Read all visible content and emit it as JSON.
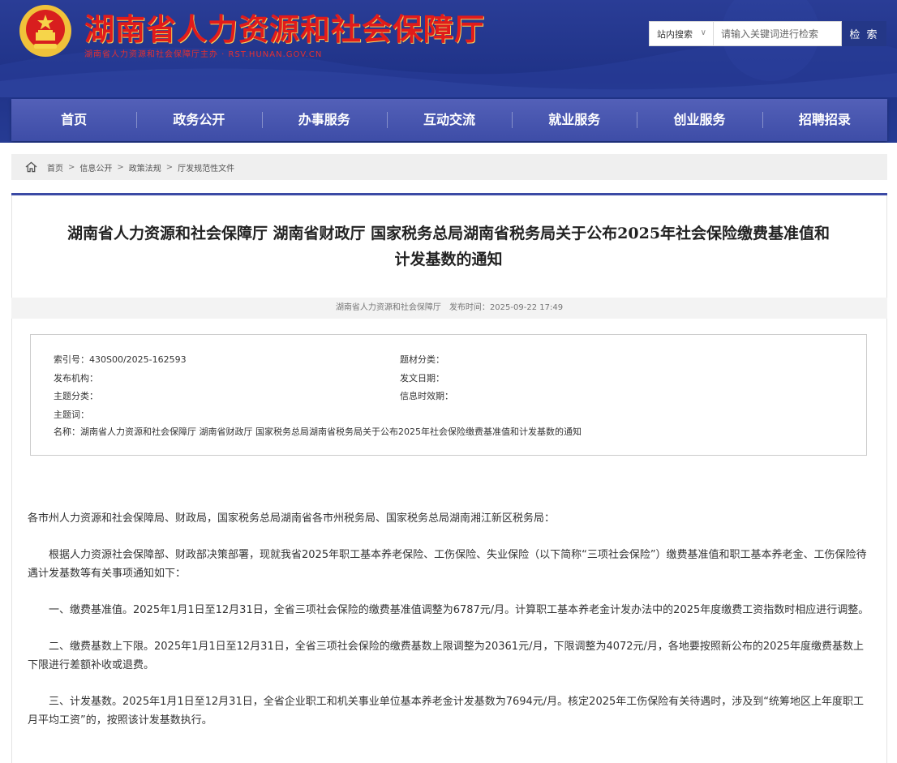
{
  "header": {
    "site_title": "湖南省人力资源和社会保障厅",
    "site_subtitle": "湖南省人力资源和社会保障厅主办 · RST.HUNAN.GOV.CN",
    "search": {
      "scope_label": "站内搜索",
      "placeholder": "请输入关键词进行检索",
      "button_label": "检 索"
    }
  },
  "nav": {
    "items": [
      "首页",
      "政务公开",
      "办事服务",
      "互动交流",
      "就业服务",
      "创业服务",
      "招聘招录"
    ]
  },
  "breadcrumb": {
    "items": [
      "首页",
      "信息公开",
      "政策法规",
      "厅发规范性文件"
    ]
  },
  "article": {
    "title_line1": "湖南省人力资源和社会保障厅 湖南省财政厅 国家税务总局湖南省税务局关于公布2025年社会保险缴费基准值和",
    "title_line2": "计发基数的通知",
    "source": "湖南省人力资源和社会保障厅",
    "publish_label": "发布时间：",
    "publish_time": "2025-09-22 17:49",
    "info": {
      "index_no": "索引号：430S00/2025-162593",
      "subject_category": "题材分类：",
      "issuer": "发布机构：",
      "issue_date": "发文日期：",
      "theme_category": "主题分类：",
      "validity": "信息时效期：",
      "keywords": "主题词：",
      "name": "名称：湖南省人力资源和社会保障厅  湖南省财政厅  国家税务总局湖南省税务局关于公布2025年社会保险缴费基准值和计发基数的通知"
    },
    "body": {
      "salutation": "各市州人力资源和社会保障局、财政局，国家税务总局湖南省各市州税务局、国家税务总局湖南湘江新区税务局：",
      "p1": "根据人力资源社会保障部、财政部决策部署，现就我省2025年职工基本养老保险、工伤保险、失业保险（以下简称“三项社会保险”）缴费基准值和职工基本养老金、工伤保险待遇计发基数等有关事项通知如下：",
      "p2": "一、缴费基准值。2025年1月1日至12月31日，全省三项社会保险的缴费基准值调整为6787元/月。计算职工基本养老金计发办法中的2025年度缴费工资指数时相应进行调整。",
      "p3": "二、缴费基数上下限。2025年1月1日至12月31日，全省三项社会保险的缴费基数上限调整为20361元/月，下限调整为4072元/月，各地要按照新公布的2025年度缴费基数上下限进行差额补收或退费。",
      "p4": "三、计发基数。2025年1月1日至12月31日，全省企业职工和机关事业单位基本养老金计发基数为7694元/月。核定2025年工伤保险有关待遇时，涉及到“统筹地区上年度职工月平均工资”的，按照该计发基数执行。"
    }
  },
  "colors": {
    "header_bg": "#1f3287",
    "title_red": "#e11b1b",
    "nav_bg": "#4553ac",
    "accent_line": "#3b4aa5"
  }
}
